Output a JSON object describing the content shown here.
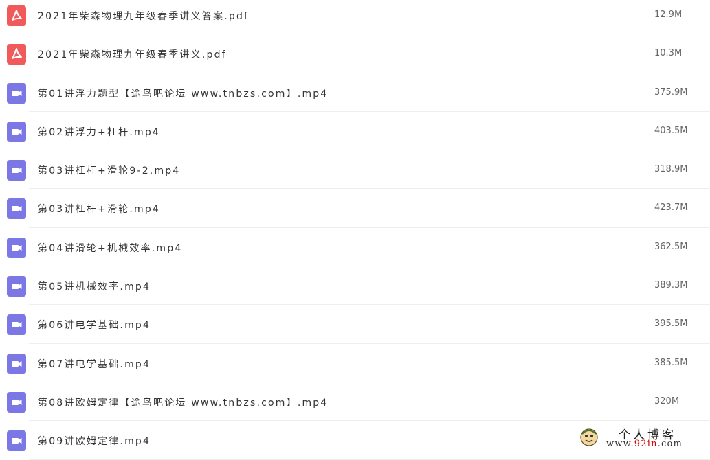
{
  "files": [
    {
      "icon": "pdf-file-icon",
      "name": "2021年柴森物理九年级春季讲义答案.pdf",
      "size": "12.9M"
    },
    {
      "icon": "pdf-file-icon",
      "name": "2021年柴森物理九年级春季讲义.pdf",
      "size": "10.3M"
    },
    {
      "icon": "video-file-icon",
      "name": "第01讲浮力题型【途鸟吧论坛 www.tnbzs.com】.mp4",
      "size": "375.9M"
    },
    {
      "icon": "video-file-icon",
      "name": "第02讲浮力+杠杆.mp4",
      "size": "403.5M"
    },
    {
      "icon": "video-file-icon",
      "name": "第03讲杠杆+滑轮9-2.mp4",
      "size": "318.9M"
    },
    {
      "icon": "video-file-icon",
      "name": "第03讲杠杆+滑轮.mp4",
      "size": "423.7M"
    },
    {
      "icon": "video-file-icon",
      "name": "第04讲滑轮+机械效率.mp4",
      "size": "362.5M"
    },
    {
      "icon": "video-file-icon",
      "name": "第05讲机械效率.mp4",
      "size": "389.3M"
    },
    {
      "icon": "video-file-icon",
      "name": "第06讲电学基础.mp4",
      "size": "395.5M"
    },
    {
      "icon": "video-file-icon",
      "name": "第07讲电学基础.mp4",
      "size": "385.5M"
    },
    {
      "icon": "video-file-icon",
      "name": "第08讲欧姆定律【途鸟吧论坛 www.tnbzs.com】.mp4",
      "size": "320M"
    },
    {
      "icon": "video-file-icon",
      "name": "第09讲欧姆定律.mp4",
      "size": ""
    }
  ],
  "watermark": {
    "title": "个人博客",
    "url_prefix": "www.",
    "url_accent": "92in",
    "url_suffix": ".com"
  },
  "colors": {
    "pdf_icon": "#f15a5a",
    "video_icon": "#7b78e6",
    "divider": "#eeeeee",
    "watermark_accent": "#cc0000"
  }
}
